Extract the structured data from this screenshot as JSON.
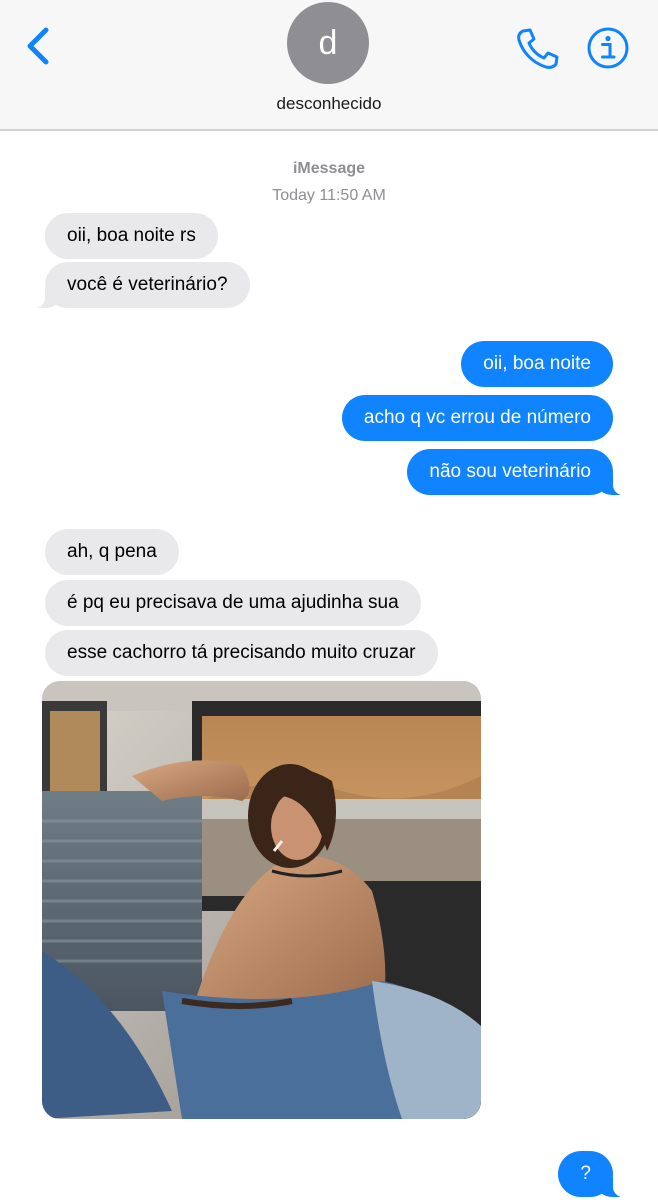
{
  "header": {
    "avatar_initial": "d",
    "contact_name": "desconhecido",
    "back_icon": "chevron-left-icon",
    "call_icon": "phone-icon",
    "info_icon": "info-icon"
  },
  "thread": {
    "service": "iMessage",
    "timestamp": "Today 11:50 AM"
  },
  "messages": [
    {
      "from": "them",
      "text": "oii, boa noite rs"
    },
    {
      "from": "them",
      "text": "você é veterinário?"
    },
    {
      "from": "me",
      "text": "oii, boa noite"
    },
    {
      "from": "me",
      "text": "acho q vc errou de número"
    },
    {
      "from": "me",
      "text": "não sou veterinário"
    },
    {
      "from": "them",
      "text": "ah, q pena"
    },
    {
      "from": "them",
      "text": "é pq eu precisava de uma ajudinha sua"
    },
    {
      "from": "them",
      "text": "esse cachorro tá precisando muito cruzar"
    },
    {
      "from": "them",
      "type": "photo",
      "text": ""
    },
    {
      "from": "me",
      "text": "?"
    }
  ],
  "colors": {
    "accent": "#1084fe",
    "incoming_bubble": "#e9e9eb",
    "header_bg": "#f7f7f7",
    "secondary_text": "#8e8e93"
  }
}
